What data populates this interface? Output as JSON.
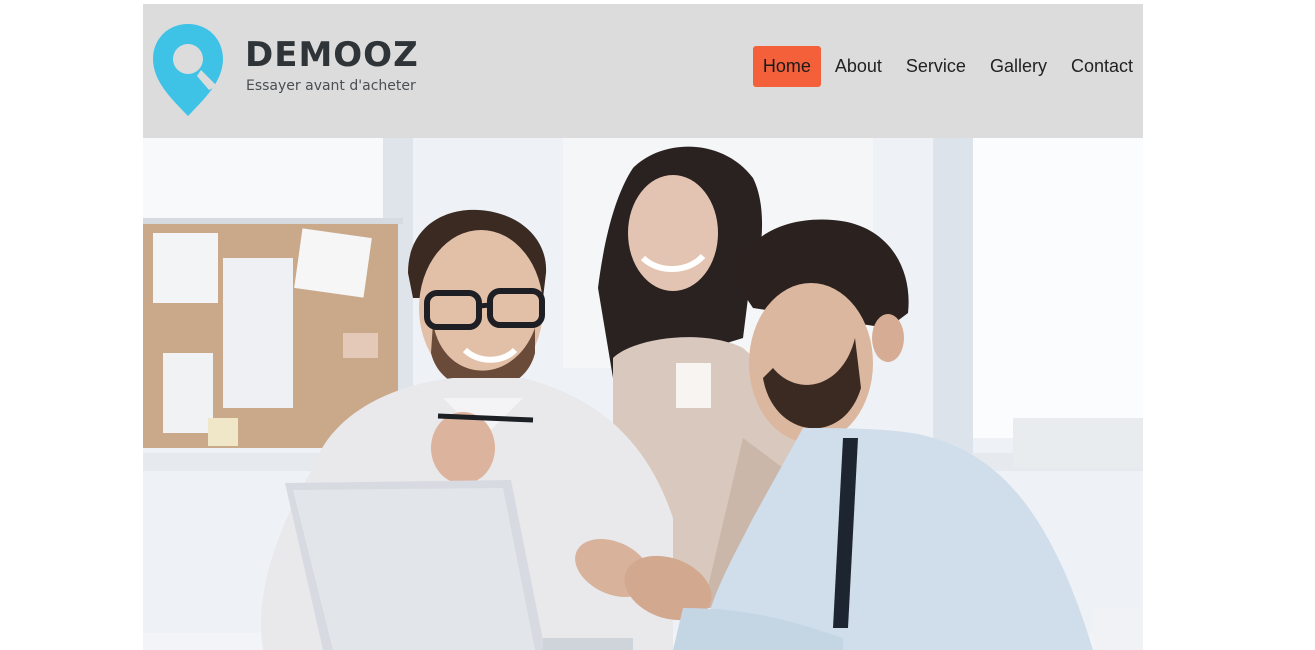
{
  "brand": {
    "name": "DEMOOZ",
    "tagline": "Essayer avant d'acheter",
    "icon": "map-pin-icon",
    "accent_color": "#3ec3e6"
  },
  "nav": {
    "items": [
      {
        "label": "Home",
        "active": true
      },
      {
        "label": "About",
        "active": false
      },
      {
        "label": "Service",
        "active": false
      },
      {
        "label": "Gallery",
        "active": false
      },
      {
        "label": "Contact",
        "active": false
      }
    ],
    "active_color": "#f3603a"
  },
  "hero": {
    "image": "photo of three business people smiling around a laptop in a bright office"
  },
  "colors": {
    "header_bg": "#dcdcdc",
    "text_dark": "#2f3438"
  }
}
